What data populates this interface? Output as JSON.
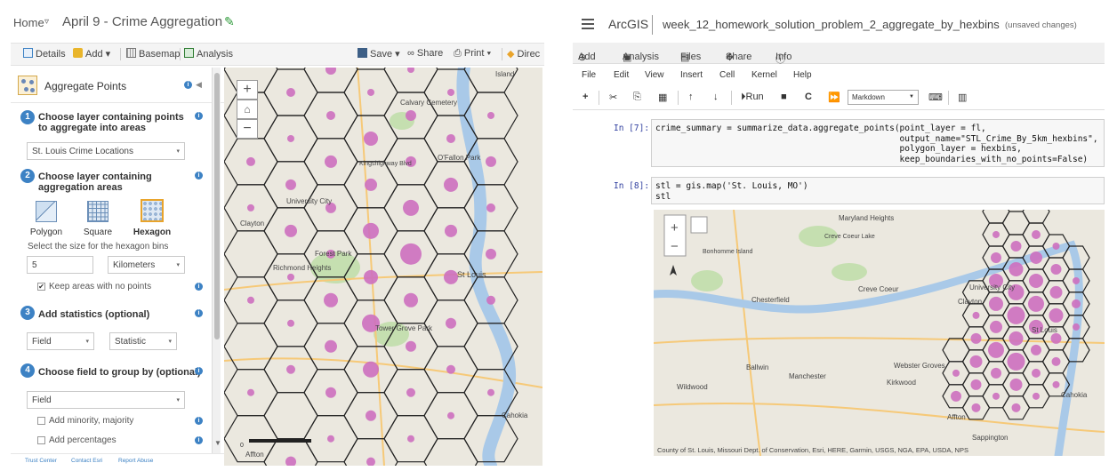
{
  "left": {
    "header": {
      "home_label": "Home",
      "home_caret": "▿",
      "map_title": "April 9 - Crime Aggregation"
    },
    "toolbar": {
      "details": "Details",
      "add": "Add",
      "basemap": "Basemap",
      "analysis": "Analysis",
      "save": "Save",
      "share": "Share",
      "print": "Print",
      "directions": "Direc"
    },
    "panel": {
      "title": "Aggregate Points",
      "step1": {
        "num": "1",
        "label": "Choose layer containing points to aggregate into areas",
        "value": "St. Louis Crime Locations"
      },
      "step2": {
        "num": "2",
        "label": "Choose layer containing aggregation areas",
        "options": [
          "Polygon",
          "Square",
          "Hexagon"
        ],
        "selected": "Hexagon",
        "size_label": "Select the size for the hexagon bins",
        "size_value": "5",
        "unit": "Kilometers",
        "keep_empty": "Keep areas with no points",
        "keep_empty_checked": true
      },
      "step3": {
        "num": "3",
        "label": "Add statistics (optional)",
        "field": "Field",
        "statistic": "Statistic"
      },
      "step4": {
        "num": "4",
        "label": "Choose field to group by (optional)",
        "field": "Field",
        "minority": "Add minority, majority",
        "percentages": "Add percentages"
      }
    },
    "footer": {
      "trust": "Trust Center",
      "contact": "Contact Esri",
      "abuse": "Report Abuse"
    },
    "map": {
      "labels": [
        "Island",
        "Calvary Cemetery",
        "O'Fallon Park",
        "University City",
        "Clayton",
        "Forest Park",
        "St Louis",
        "Richmond Heights",
        "Tower Grove Park",
        "Cahokia",
        "Affton",
        "Kingshighway Blvd"
      ],
      "scale": "0"
    }
  },
  "right": {
    "brand": "ArcGIS",
    "notebook_title": "week_12_homework_solution_problem_2_aggregate_by_hexbins",
    "unsaved": "(unsaved changes)",
    "bar": {
      "add": "Add",
      "analysis": "Analysis",
      "files": "Files",
      "share": "Share",
      "info": "Info"
    },
    "menu": [
      "File",
      "Edit",
      "View",
      "Insert",
      "Cell",
      "Kernel",
      "Help"
    ],
    "run_label": "Run",
    "cell_type": "Markdown",
    "cells": [
      {
        "prompt": "In [7]:",
        "lines": [
          "crime_summary = summarize_data.aggregate_points(point_layer = fl,",
          "                                                output_name=\"STL_Crime_By_5km_hexbins\",",
          "                                                polygon_layer = hexbins,",
          "                                                keep_boundaries_with_no_points=False)"
        ]
      },
      {
        "prompt": "In [8]:",
        "lines": [
          "stl = gis.map('St. Louis, MO')",
          "stl"
        ]
      }
    ],
    "outmap": {
      "labels": [
        "Maryland Heights",
        "Creve Coeur Lake",
        "Bonhomme Island",
        "Chesterfield",
        "Creve Coeur",
        "Clayton",
        "University City",
        "St Louis",
        "Ballwin",
        "Manchester",
        "Webster Groves",
        "Kirkwood",
        "Wildwood",
        "Affton",
        "Cahokia",
        "Sappington"
      ],
      "attribution": "County of St. Louis, Missouri Dept. of Conservation, Esri, HERE, Garmin, USGS, NGA, EPA, USDA, NPS"
    }
  },
  "colors": {
    "accent": "#3d82c4",
    "hexfill": "#cd6fbf",
    "river": "#a9c9e8",
    "park": "#c5dfb0"
  }
}
